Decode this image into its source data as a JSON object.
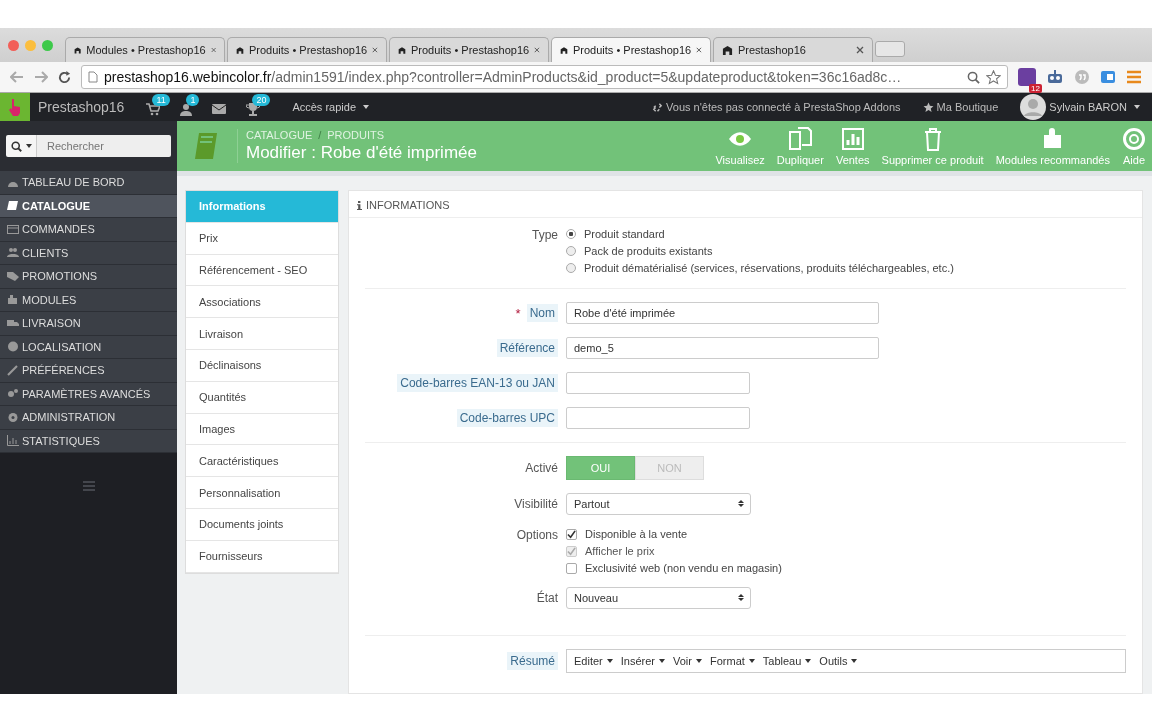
{
  "browser": {
    "tabs": [
      {
        "title": "Modules • Prestashop16",
        "selected": false
      },
      {
        "title": "Produits • Prestashop16",
        "selected": false
      },
      {
        "title": "Produits • Prestashop16",
        "selected": false
      },
      {
        "title": "Produits • Prestashop16",
        "selected": true
      },
      {
        "title": "Prestashop16",
        "selected": false
      }
    ],
    "address": {
      "host": "prestashop16.webincolor.fr",
      "path": "/admin1591/index.php?controller=AdminProducts&id_product=5&updateproduct&token=36c16ad8c…"
    },
    "extension_badge": "12"
  },
  "header": {
    "shop_name": "Prestashop16",
    "orders_badge": "11",
    "customers_badge": "1",
    "trophy_badge": "20",
    "quick_access": "Accès rapide",
    "addons_notice": "Vous n'êtes pas connecté à PrestaShop Addons",
    "shop_link": "Ma Boutique",
    "user": "Sylvain BARON"
  },
  "search": {
    "placeholder": "Rechercher"
  },
  "sidebar": {
    "items": [
      {
        "label": "TABLEAU DE BORD",
        "selected": false
      },
      {
        "label": "CATALOGUE",
        "selected": true
      },
      {
        "label": "COMMANDES",
        "selected": false
      },
      {
        "label": "CLIENTS",
        "selected": false
      },
      {
        "label": "PROMOTIONS",
        "selected": false
      },
      {
        "label": "MODULES",
        "selected": false
      },
      {
        "label": "LIVRAISON",
        "selected": false
      },
      {
        "label": "LOCALISATION",
        "selected": false
      },
      {
        "label": "PRÉFÉRENCES",
        "selected": false
      },
      {
        "label": "PARAMÈTRES AVANCÉS",
        "selected": false
      },
      {
        "label": "ADMINISTRATION",
        "selected": false
      },
      {
        "label": "STATISTIQUES",
        "selected": false
      }
    ]
  },
  "toolbar": {
    "breadcrumb": [
      "CATALOGUE",
      "PRODUITS"
    ],
    "separator": "/",
    "title": "Modifier : Robe d'été imprimée",
    "actions": [
      {
        "label": "Visualisez"
      },
      {
        "label": "Dupliquer"
      },
      {
        "label": "Ventes"
      },
      {
        "label": "Supprimer ce produit"
      },
      {
        "label": "Modules recommandés"
      },
      {
        "label": "Aide"
      }
    ]
  },
  "product_tabs": [
    {
      "label": "Informations",
      "selected": true
    },
    {
      "label": "Prix",
      "selected": false
    },
    {
      "label": "Référencement - SEO",
      "selected": false
    },
    {
      "label": "Associations",
      "selected": false
    },
    {
      "label": "Livraison",
      "selected": false
    },
    {
      "label": "Déclinaisons",
      "selected": false
    },
    {
      "label": "Quantités",
      "selected": false
    },
    {
      "label": "Images",
      "selected": false
    },
    {
      "label": "Caractéristiques",
      "selected": false
    },
    {
      "label": "Personnalisation",
      "selected": false
    },
    {
      "label": "Documents joints",
      "selected": false
    },
    {
      "label": "Fournisseurs",
      "selected": false
    }
  ],
  "panel": {
    "heading": "INFORMATIONS",
    "type": {
      "label": "Type",
      "options": [
        {
          "label": "Produit standard",
          "selected": true
        },
        {
          "label": "Pack de produits existants",
          "selected": false
        },
        {
          "label": "Produit dématérialisé (services, réservations, produits téléchargeables, etc.)",
          "selected": false
        }
      ]
    },
    "fields": [
      {
        "label": "Nom",
        "required_mark": "*",
        "value": "Robe d'été imprimée"
      },
      {
        "label": "Référence",
        "value": "demo_5"
      },
      {
        "label": "Code-barres EAN-13 ou JAN"
      },
      {
        "label": "Code-barres UPC"
      }
    ],
    "active": {
      "label": "Activé",
      "options": [
        {
          "label": "OUI",
          "selected": true
        },
        {
          "label": "NON",
          "selected": false
        }
      ]
    },
    "visibility": {
      "label": "Visibilité",
      "value": "Partout"
    },
    "options": {
      "label": "Options",
      "items": [
        {
          "label": "Disponible à la vente",
          "checked": true,
          "disabled": false
        },
        {
          "label": "Afficher le prix",
          "checked": true,
          "disabled": true
        },
        {
          "label": "Exclusivité web (non vendu en magasin)",
          "checked": false,
          "disabled": false
        }
      ]
    },
    "condition": {
      "label": "État",
      "value": "Nouveau"
    },
    "summary": {
      "label": "Résumé",
      "menus": [
        "Editer",
        "Insérer",
        "Voir",
        "Format",
        "Tableau",
        "Outils"
      ]
    }
  }
}
